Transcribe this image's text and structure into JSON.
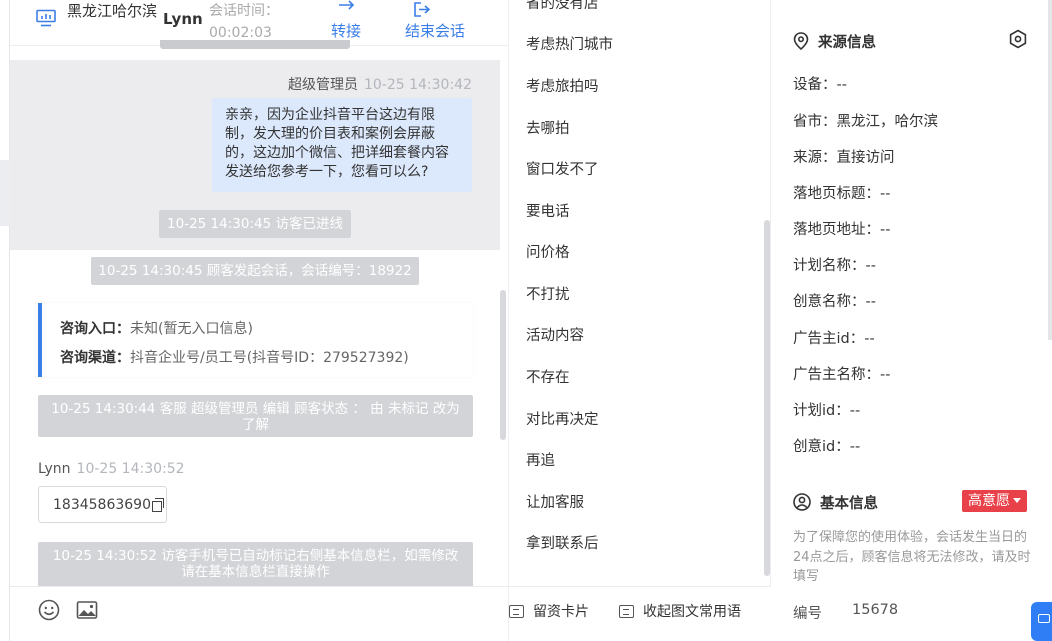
{
  "chat": {
    "header": {
      "location": "黑龙江哈尔滨",
      "visitor_name": "Lynn",
      "session_time_label": "会话时间：",
      "session_time_value": "00:02:03",
      "transfer_label": "转接",
      "end_label": "结束会话"
    },
    "messages": {
      "staff_name": "超级管理员",
      "staff_time": "10-25 14:30:42",
      "staff_text": "亲亲，因为企业抖音平台这边有限制，发大理的价目表和案例会屏蔽的，这边加个微信、把详细套餐内容发送给您参考一下，您看可以么?",
      "sys_visitor_online": "10-25 14:30:45 访客已进线",
      "sys_session_start": "10-25 14:30:45 顾客发起会话，会话编号：18922",
      "consult_entry_label": "咨询入口：",
      "consult_entry_value": "未知(暂无入口信息)",
      "consult_channel_label": "咨询渠道：",
      "consult_channel_value": "抖音企业号/员工号(抖音号ID：279527392)",
      "sys_status_change": "10-25 14:30:44 客服 超级管理员 编辑 顾客状态 ： 由 未标记 改为 了解",
      "visitor_name": "Lynn",
      "visitor_time": "10-25 14:30:52",
      "visitor_text": "18345863690",
      "sys_phone_marked": "10-25 14:30:52 访客手机号已自动标记右侧基本信息栏，如需修改请在基本信息栏直接操作"
    }
  },
  "phrases": {
    "items": [
      "省的没有店",
      "考虑热门城市",
      "考虑旅拍吗",
      "去哪拍",
      "窗口发不了",
      "要电话",
      "问价格",
      "不打扰",
      "活动内容",
      "不存在",
      "对比再决定",
      "再追",
      "让加客服",
      "拿到联系后"
    ],
    "footer": {
      "card_label": "留资卡片",
      "collapse_label": "收起图文常用语"
    }
  },
  "info": {
    "source": {
      "title": "来源信息",
      "fields": [
        {
          "label": "设备：",
          "value": "--"
        },
        {
          "label": "省市：",
          "value": "黑龙江，哈尔滨"
        },
        {
          "label": "来源：",
          "value": "直接访问"
        },
        {
          "label": "落地页标题：",
          "value": "--"
        },
        {
          "label": "落地页地址：",
          "value": "--"
        },
        {
          "label": "计划名称：",
          "value": "--"
        },
        {
          "label": "创意名称：",
          "value": "--"
        },
        {
          "label": "广告主id：",
          "value": "--"
        },
        {
          "label": "广告主名称：",
          "value": "--"
        },
        {
          "label": "计划id：",
          "value": "--"
        },
        {
          "label": "创意id：",
          "value": "--"
        }
      ]
    },
    "basic": {
      "title": "基本信息",
      "intent_badge": "高意愿",
      "note": "为了保障您的使用体验，会话发生当日的24点之后，顾客信息将无法修改，请及时填写",
      "id_label": "编号",
      "id_value": "15678"
    }
  },
  "colors": {
    "accent": "#3a7ee8",
    "staff_bubble": "#dce8fb",
    "badge": "#e8414a",
    "system_msg": "#d3d4d7"
  }
}
